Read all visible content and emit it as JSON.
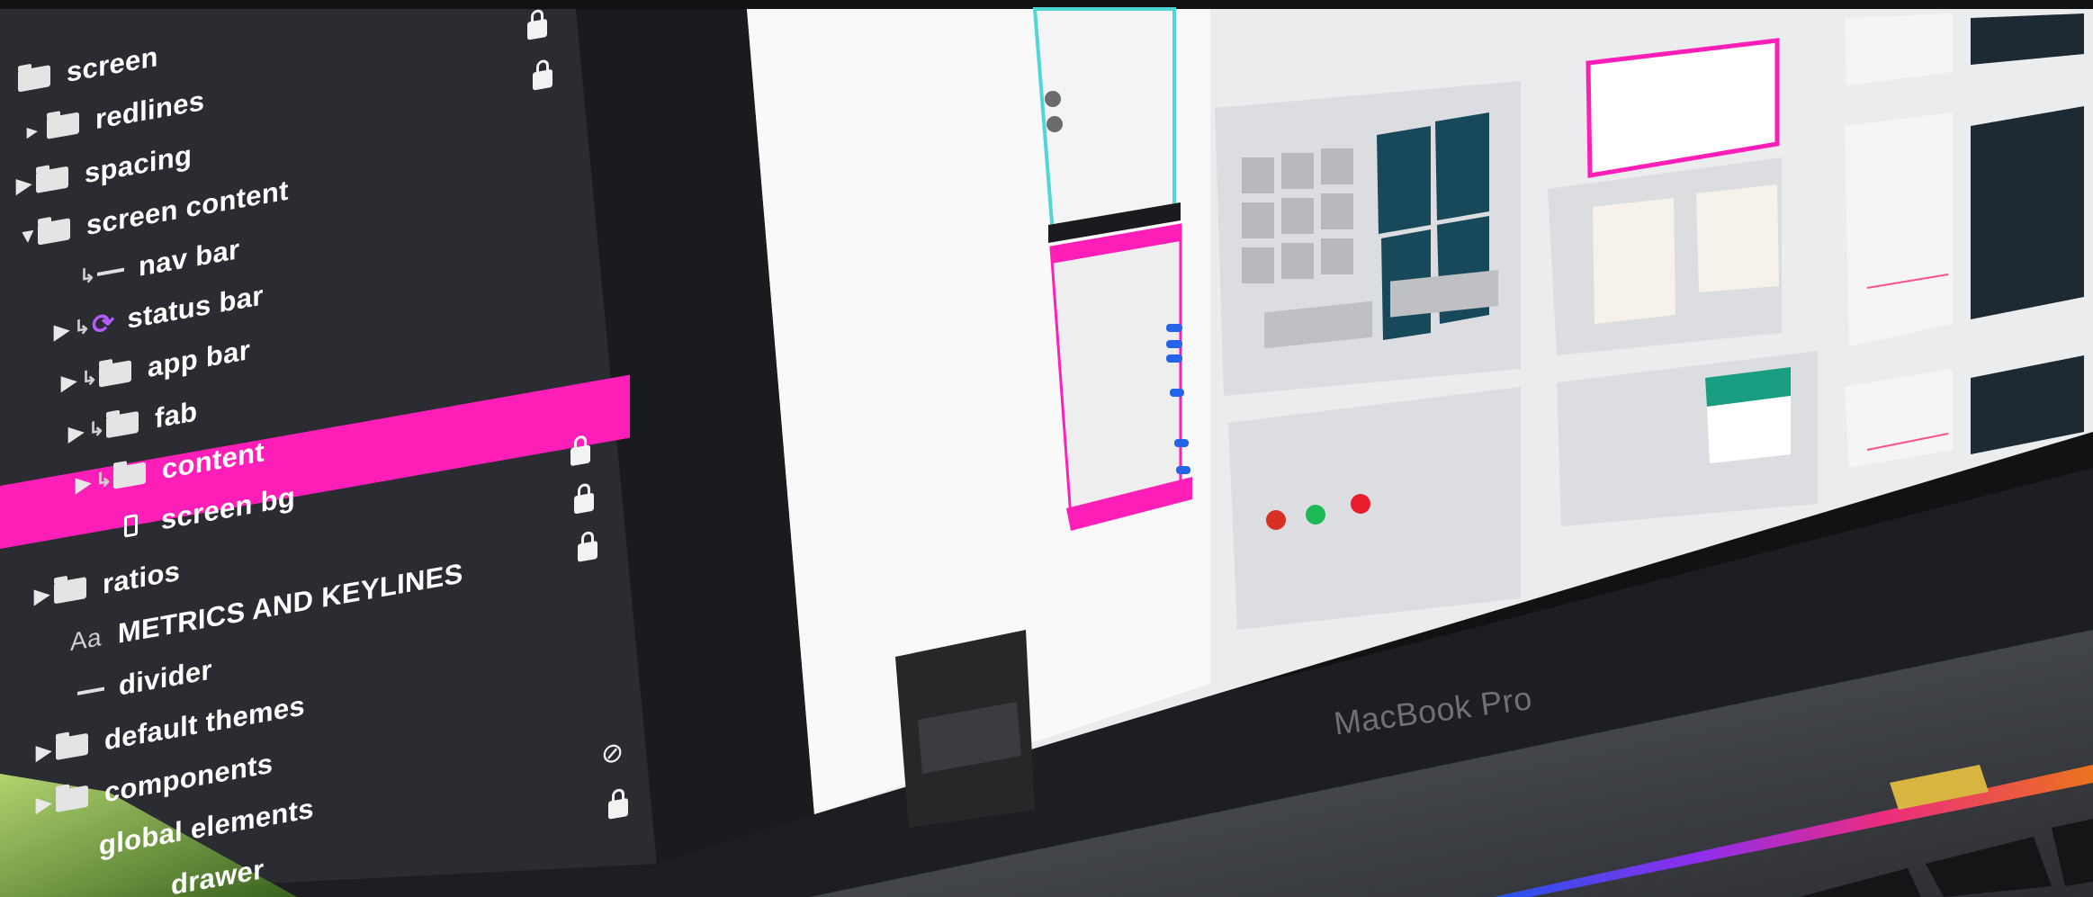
{
  "layers": [
    {
      "label": "screen",
      "icon": "folder-icon",
      "locked": true
    },
    {
      "label": "redlines",
      "icon": "folder-icon",
      "locked": true
    },
    {
      "label": "spacing",
      "icon": "folder-icon"
    },
    {
      "label": "screen content",
      "icon": "folder-icon",
      "expanded": true
    },
    {
      "label": "nav bar",
      "icon": "line-icon"
    },
    {
      "label": "status bar",
      "icon": "sync-icon"
    },
    {
      "label": "app bar",
      "icon": "folder-icon"
    },
    {
      "label": "fab",
      "icon": "folder-icon"
    },
    {
      "label": "content",
      "icon": "folder-icon",
      "locked": true
    },
    {
      "label": "screen bg",
      "icon": "rectangle-icon",
      "selected": true,
      "locked": true
    },
    {
      "label": "ratios",
      "icon": "folder-icon",
      "locked": true
    },
    {
      "label": "METRICS AND KEYLINES",
      "icon": "text-icon"
    },
    {
      "label": "divider",
      "icon": "line-icon"
    },
    {
      "label": "default themes",
      "icon": "folder-icon"
    },
    {
      "label": "components",
      "icon": "folder-icon",
      "hidden": true
    },
    {
      "label": "global elements",
      "icon": "folder-icon",
      "locked": true
    },
    {
      "label": "drawer",
      "icon": "folder-icon"
    }
  ],
  "laptop": {
    "brand": "MacBook Pro"
  },
  "colors": {
    "accent_pink": "#ff1fb8",
    "panel_dark": "#2a2c31",
    "canvas_light": "#ebecee",
    "teal_card": "#17495a",
    "keylines": "#4fd6d6"
  }
}
